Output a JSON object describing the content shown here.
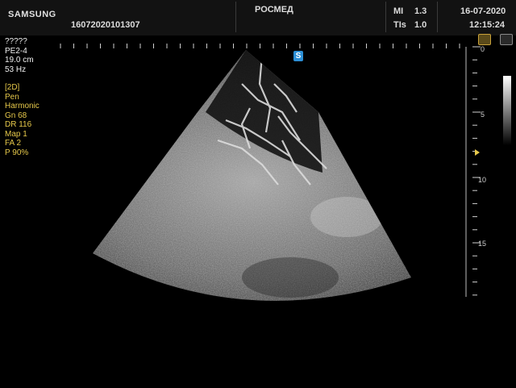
{
  "header": {
    "brand": "SAMSUNG",
    "patient_id": "16072020101307",
    "institution": "РОСМЕД",
    "mi_label": "MI",
    "mi_value": "1.3",
    "tis_label": "TIs",
    "tis_value": "1.0",
    "date": "16-07-2020",
    "time": "12:15:24"
  },
  "probe": {
    "preset": "?????",
    "name": "PE2-4",
    "depth": "19.0 cm",
    "frame_rate": "53 Hz"
  },
  "imaging_params": [
    "[2D]",
    "Pen",
    "Harmonic",
    "Gn  68",
    "DR  116",
    "Map  1",
    "FA  2",
    "P   90%"
  ],
  "depth_scale": {
    "labels": [
      "0",
      "5",
      "10",
      "15"
    ]
  },
  "orientation_marker": "S",
  "colors": {
    "marker": "#2c8fd6",
    "params_text": "#e6c84a",
    "focus_marker": "#e6c84a"
  }
}
